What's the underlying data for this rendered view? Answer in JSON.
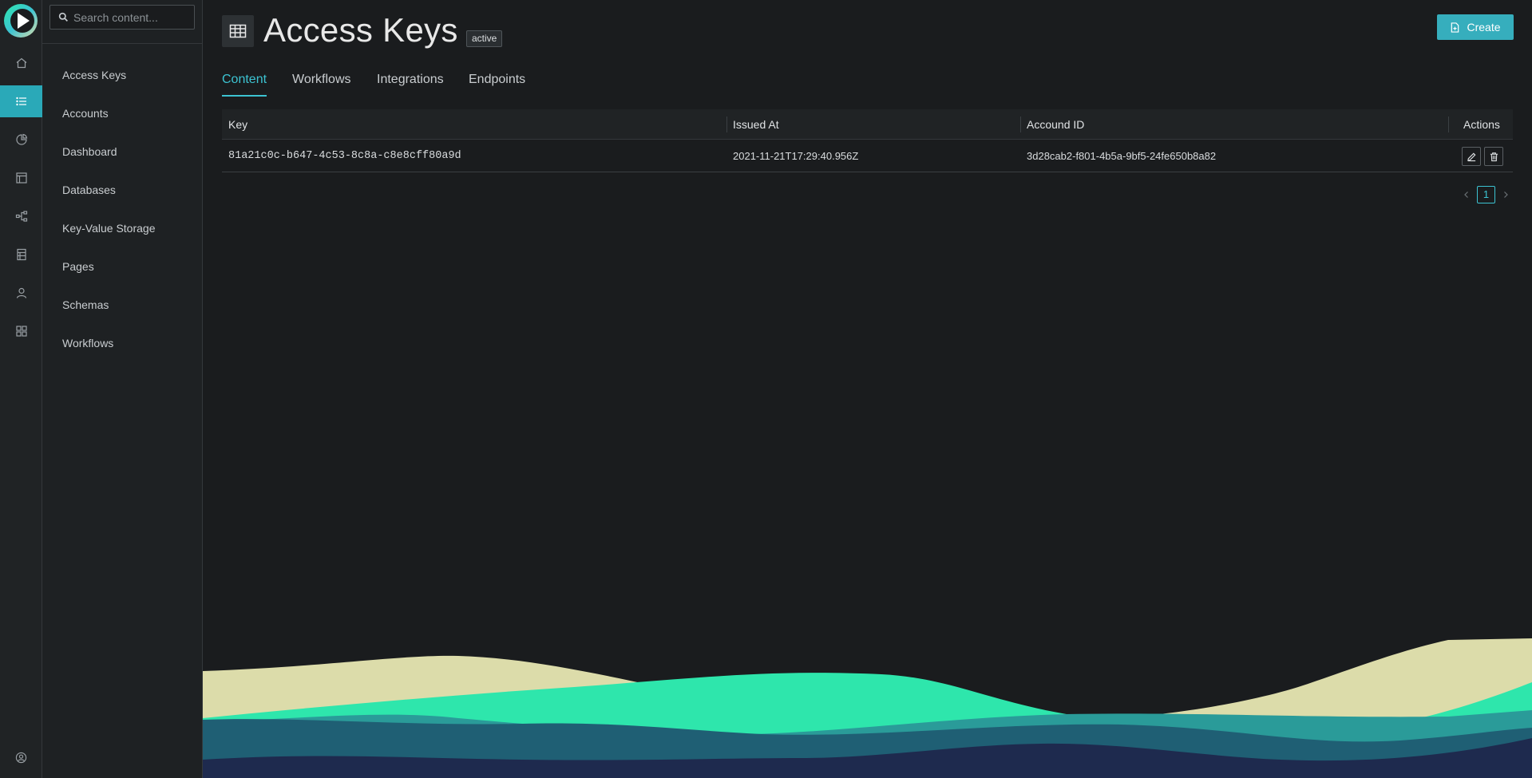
{
  "app": {
    "logo": "play-logo"
  },
  "rail": {
    "items": [
      {
        "icon": "home-icon"
      },
      {
        "icon": "list-icon",
        "active": true
      },
      {
        "icon": "pie-chart-icon"
      },
      {
        "icon": "layout-icon"
      },
      {
        "icon": "workflow-icon"
      },
      {
        "icon": "database-icon"
      },
      {
        "icon": "user-icon"
      },
      {
        "icon": "apps-grid-icon"
      }
    ],
    "bottom_icon": "user-circle-icon"
  },
  "search": {
    "placeholder": "Search content..."
  },
  "sidebar": {
    "items": [
      {
        "label": "Access Keys"
      },
      {
        "label": "Accounts"
      },
      {
        "label": "Dashboard"
      },
      {
        "label": "Databases"
      },
      {
        "label": "Key-Value Storage"
      },
      {
        "label": "Pages"
      },
      {
        "label": "Schemas"
      },
      {
        "label": "Workflows"
      }
    ]
  },
  "header": {
    "title": "Access Keys",
    "badge": "active",
    "create_label": "Create"
  },
  "tabs": [
    {
      "label": "Content",
      "active": true
    },
    {
      "label": "Workflows"
    },
    {
      "label": "Integrations"
    },
    {
      "label": "Endpoints"
    }
  ],
  "table": {
    "columns": [
      "Key",
      "Issued At",
      "Accound ID",
      "Actions"
    ],
    "rows": [
      {
        "key": "81a21c0c-b647-4c53-8c8a-c8e8cff80a9d",
        "issued_at": "2021-11-21T17:29:40.956Z",
        "account_id": "3d28cab2-f801-4b5a-9bf5-24fe650b8a82"
      }
    ]
  },
  "pagination": {
    "current": "1"
  },
  "colors": {
    "accent": "#3cc3d2",
    "wave_cream": "#dcdcaa",
    "wave_mint": "#2ee6ac",
    "wave_teal": "#2a9b99",
    "wave_slate": "#1f5f74",
    "wave_navy": "#1e2a4e"
  }
}
